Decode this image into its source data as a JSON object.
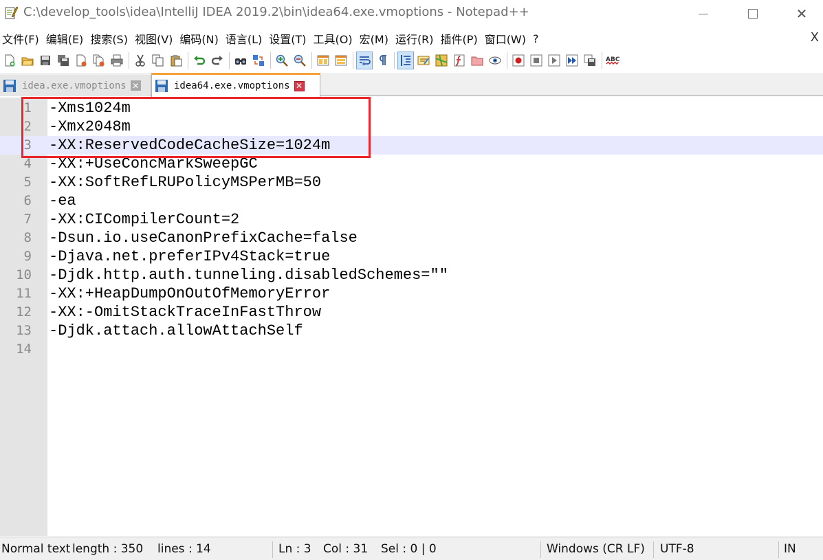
{
  "window": {
    "title": "C:\\develop_tools\\idea\\IntelliJ IDEA 2019.2\\bin\\idea64.exe.vmoptions - Notepad++",
    "minimize_icon": "minimize-icon",
    "maximize_icon": "maximize-icon",
    "close_symbol": "✕"
  },
  "menu": {
    "items": [
      {
        "label": "文件(F)"
      },
      {
        "label": "编辑(E)"
      },
      {
        "label": "搜索(S)"
      },
      {
        "label": "视图(V)"
      },
      {
        "label": "编码(N)"
      },
      {
        "label": "语言(L)"
      },
      {
        "label": "设置(T)"
      },
      {
        "label": "工具(O)"
      },
      {
        "label": "宏(M)"
      },
      {
        "label": "运行(R)"
      },
      {
        "label": "插件(P)"
      },
      {
        "label": "窗口(W)"
      },
      {
        "label": "?"
      }
    ],
    "close_doc": "X"
  },
  "toolbar": {
    "icons": [
      "new-file-icon",
      "open-file-icon",
      "save-icon",
      "save-all-icon",
      "close-icon",
      "close-all-icon",
      "print-icon",
      "cut-icon",
      "copy-icon",
      "paste-icon",
      "undo-icon",
      "redo-icon",
      "find-icon",
      "replace-icon",
      "zoom-in-icon",
      "zoom-out-icon",
      "sync-vertical-icon",
      "sync-horizontal-icon",
      "word-wrap-icon",
      "show-all-chars-icon",
      "indent-guide-icon",
      "user-language-icon",
      "doc-map-icon",
      "function-list-icon",
      "folder-workspace-icon",
      "monitoring-icon",
      "record-macro-icon",
      "stop-record-icon",
      "play-macro-icon",
      "run-macro-multiple-icon",
      "save-macro-icon",
      "spell-check-icon"
    ],
    "spell_label": "ABC"
  },
  "tabs": [
    {
      "label": "idea.exe.vmoptions",
      "active": false
    },
    {
      "label": "idea64.exe.vmoptions",
      "active": true
    }
  ],
  "editor": {
    "current_line": 3,
    "lines": [
      {
        "no": "1",
        "text": "-Xms1024m"
      },
      {
        "no": "2",
        "text": "-Xmx2048m"
      },
      {
        "no": "3",
        "text": "-XX:ReservedCodeCacheSize=1024m"
      },
      {
        "no": "4",
        "text": "-XX:+UseConcMarkSweepGC"
      },
      {
        "no": "5",
        "text": "-XX:SoftRefLRUPolicyMSPerMB=50"
      },
      {
        "no": "6",
        "text": "-ea"
      },
      {
        "no": "7",
        "text": "-XX:CICompilerCount=2"
      },
      {
        "no": "8",
        "text": "-Dsun.io.useCanonPrefixCache=false"
      },
      {
        "no": "9",
        "text": "-Djava.net.preferIPv4Stack=true"
      },
      {
        "no": "10",
        "text": "-Djdk.http.auth.tunneling.disabledSchemes=\"\""
      },
      {
        "no": "11",
        "text": "-XX:+HeapDumpOnOutOfMemoryError"
      },
      {
        "no": "12",
        "text": "-XX:-OmitStackTraceInFastThrow"
      },
      {
        "no": "13",
        "text": "-Djdk.attach.allowAttachSelf"
      },
      {
        "no": "14",
        "text": ""
      }
    ],
    "annotation_color": "#e8262b"
  },
  "status": {
    "type": "Normal text",
    "length": "length : 350",
    "lines": "lines : 14",
    "ln": "Ln : 3",
    "col": "Col : 31",
    "sel": "Sel : 0 | 0",
    "eol": "Windows (CR LF)",
    "encoding": "UTF-8",
    "mode": "IN"
  }
}
